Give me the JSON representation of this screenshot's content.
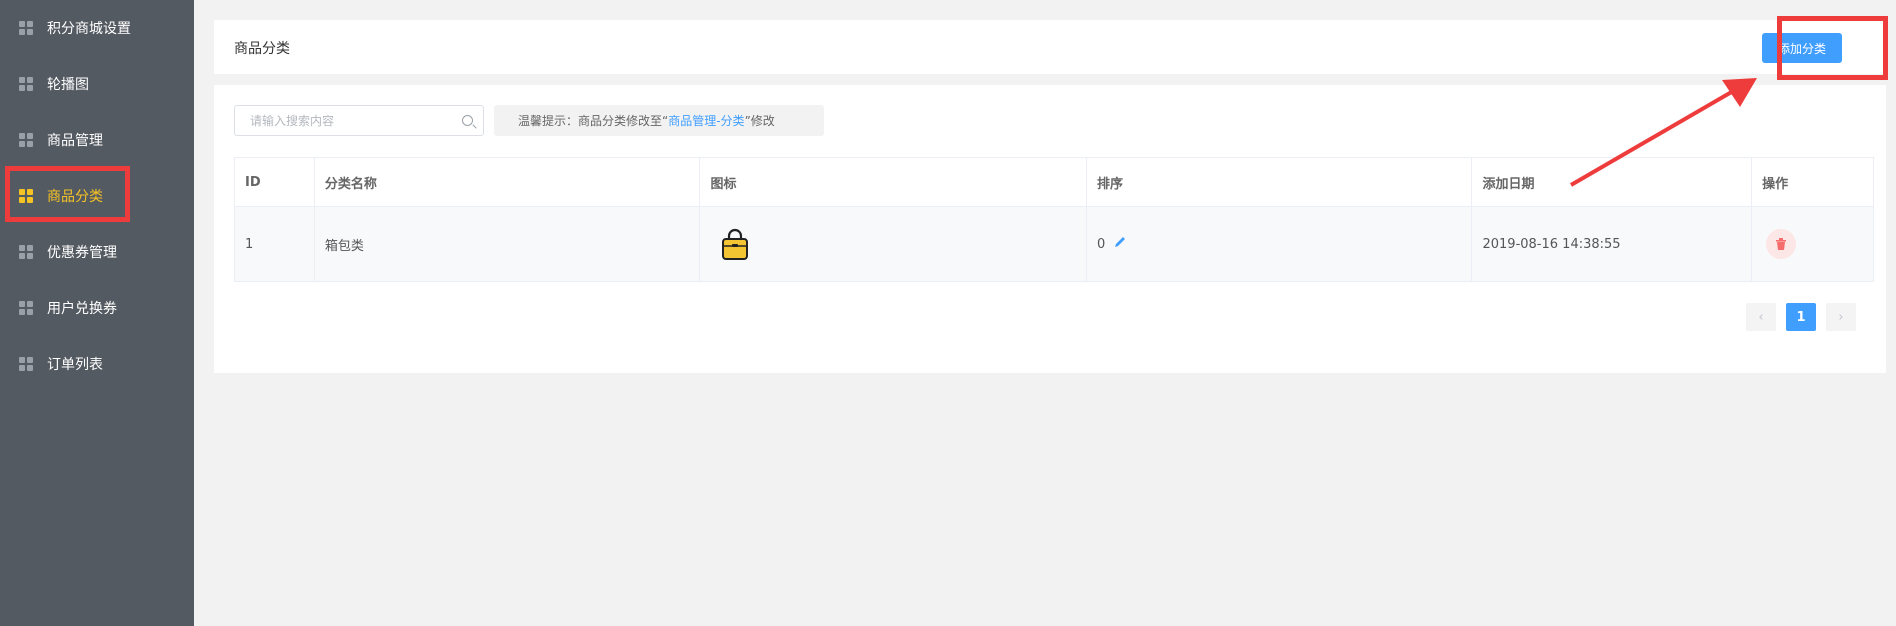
{
  "sidebar": {
    "items": [
      {
        "label": "积分商城设置",
        "active": false
      },
      {
        "label": "轮播图",
        "active": false
      },
      {
        "label": "商品管理",
        "active": false
      },
      {
        "label": "商品分类",
        "active": true
      },
      {
        "label": "优惠券管理",
        "active": false
      },
      {
        "label": "用户兑换券",
        "active": false
      },
      {
        "label": "订单列表",
        "active": false
      }
    ]
  },
  "header": {
    "title": "商品分类",
    "add_button": "添加分类"
  },
  "toolbar": {
    "search_placeholder": "请输入搜索内容",
    "hint_prefix": "温馨提示：商品分类修改至“",
    "hint_link": "商品管理-分类",
    "hint_suffix": "”修改"
  },
  "table": {
    "columns": [
      "ID",
      "分类名称",
      "图标",
      "排序",
      "添加日期",
      "操作"
    ],
    "rows": [
      {
        "id": "1",
        "name": "箱包类",
        "icon": "bag-icon",
        "sort": "0",
        "date": "2019-08-16 14:38:55"
      }
    ]
  },
  "pagination": {
    "prev_icon": "chevron-left-icon",
    "current": "1",
    "next_icon": "chevron-right-icon"
  },
  "colors": {
    "sidebar_bg": "#545a62",
    "active": "#f5c324",
    "primary": "#409eff",
    "annotation": "#ee3b3b"
  }
}
